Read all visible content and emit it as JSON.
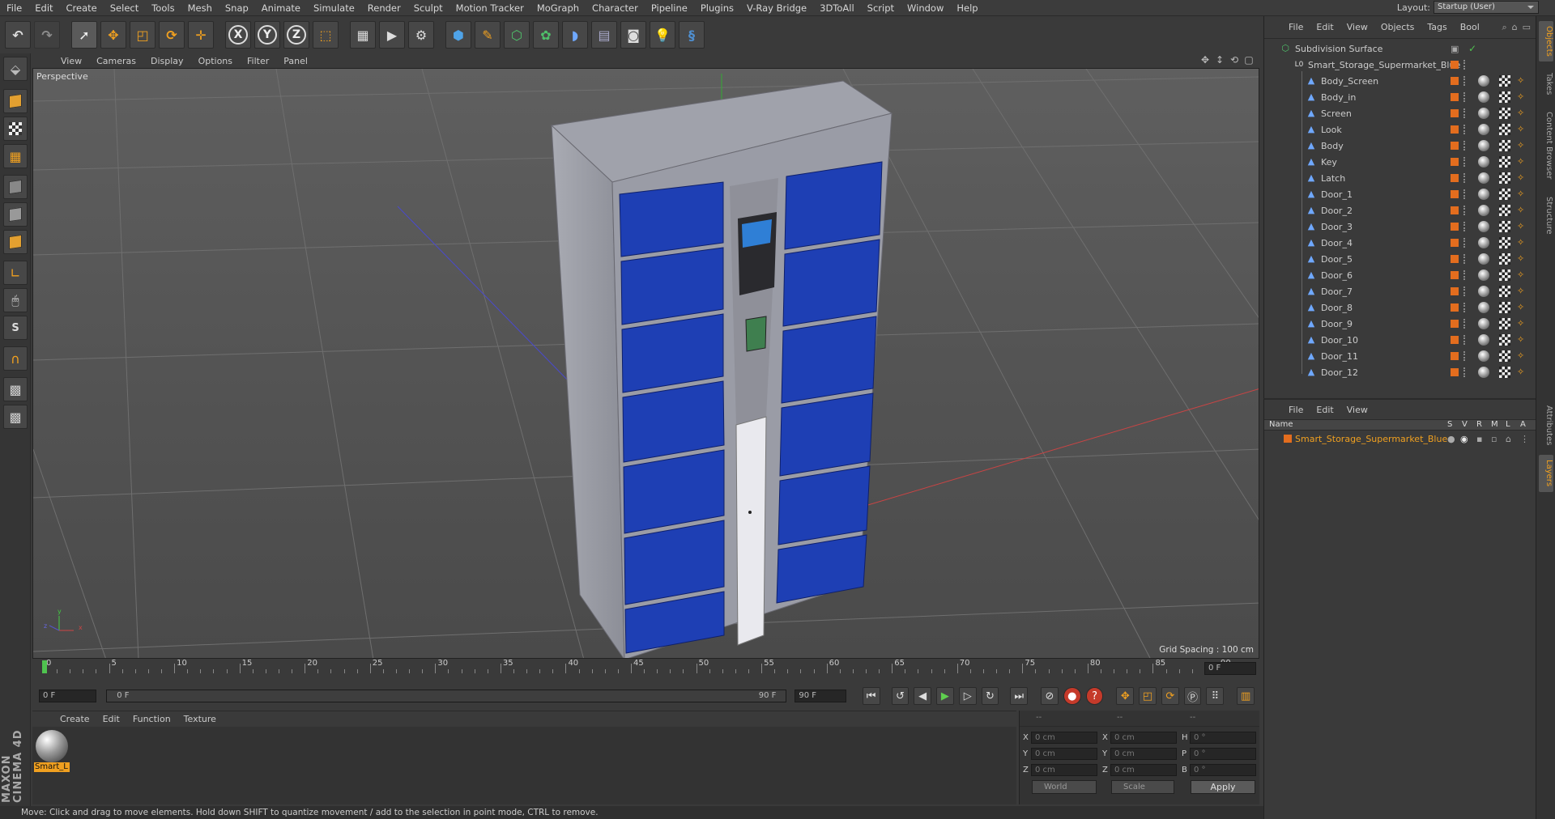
{
  "menubar": {
    "items": [
      "File",
      "Edit",
      "Create",
      "Select",
      "Tools",
      "Mesh",
      "Snap",
      "Animate",
      "Simulate",
      "Render",
      "Sculpt",
      "Motion Tracker",
      "MoGraph",
      "Character",
      "Pipeline",
      "Plugins",
      "V-Ray Bridge",
      "3DToAll",
      "Script",
      "Window",
      "Help"
    ],
    "layout_label": "Layout:",
    "layout_value": "Startup (User)"
  },
  "toolbar": {
    "axis_x": "X",
    "axis_y": "Y",
    "axis_z": "Z",
    "icons": [
      "undo-icon",
      "redo-icon",
      "select-arrow-icon",
      "move-icon",
      "scale-icon",
      "rotate-icon",
      "transform-icon",
      "axis-x-icon",
      "axis-y-icon",
      "axis-z-icon",
      "coordinate-system-icon",
      "render-view-icon",
      "render-picture-viewer-icon",
      "edit-render-settings-icon",
      "cube-icon",
      "pen-icon",
      "subdivision-icon",
      "cloner-icon",
      "deformer-icon",
      "floor-icon",
      "camera-icon",
      "light-icon",
      "python-icon"
    ]
  },
  "left_tools": {
    "s_label": "S",
    "brand": "MAXON CINEMA 4D"
  },
  "viewport": {
    "menu": [
      "View",
      "Cameras",
      "Display",
      "Options",
      "Filter",
      "Panel"
    ],
    "name": "Perspective",
    "grid_spacing": "Grid Spacing : 100 cm",
    "axis_x": "x",
    "axis_y": "y",
    "axis_z": "z"
  },
  "timeline": {
    "ticks": [
      0,
      5,
      10,
      15,
      20,
      25,
      30,
      35,
      40,
      45,
      50,
      55,
      60,
      65,
      70,
      75,
      80,
      85,
      90
    ],
    "current_frame_field": "0 F"
  },
  "controls": {
    "start_field": "0 F",
    "range_start": "0 F",
    "range_end": "90 F",
    "end_field": "90 F"
  },
  "material_manager": {
    "menu": [
      "Create",
      "Edit",
      "Function",
      "Texture"
    ],
    "material_name": "Smart_L"
  },
  "coordinates": {
    "header": [
      "--",
      "--",
      "--"
    ],
    "rows": [
      {
        "a": "X",
        "a_val": "0 cm",
        "b": "X",
        "b_val": "0 cm",
        "c": "H",
        "c_val": "0 °"
      },
      {
        "a": "Y",
        "a_val": "0 cm",
        "b": "Y",
        "b_val": "0 cm",
        "c": "P",
        "c_val": "0 °"
      },
      {
        "a": "Z",
        "a_val": "0 cm",
        "b": "Z",
        "b_val": "0 cm",
        "c": "B",
        "c_val": "0 °"
      }
    ],
    "space": "World",
    "mode": "Scale",
    "apply": "Apply"
  },
  "status": {
    "text": "Move: Click and drag to move elements. Hold down SHIFT to quantize movement / add to the selection in point mode, CTRL to remove."
  },
  "object_manager": {
    "menu": [
      "File",
      "Edit",
      "View",
      "Objects",
      "Tags",
      "Bool"
    ],
    "root": "Subdivision Surface",
    "group": "Smart_Storage_Supermarket_Blue",
    "children": [
      "Body_Screen",
      "Body_in",
      "Screen",
      "Look",
      "Body",
      "Key",
      "Latch",
      "Door_1",
      "Door_2",
      "Door_3",
      "Door_4",
      "Door_5",
      "Door_6",
      "Door_7",
      "Door_8",
      "Door_9",
      "Door_10",
      "Door_11",
      "Door_12"
    ]
  },
  "layer_manager": {
    "menu": [
      "File",
      "Edit",
      "View"
    ],
    "columns": {
      "name": "Name",
      "s": "S",
      "v": "V",
      "r": "R",
      "m": "M",
      "l": "L",
      "a": "A"
    },
    "layer": "Smart_Storage_Supermarket_Blue"
  },
  "side_tabs": {
    "objects": "Objects",
    "takes": "Takes",
    "content_browser": "Content Browser",
    "structure": "Structure",
    "attributes": "Attributes",
    "layers": "Layers"
  },
  "colors": {
    "accent": "#f0a020",
    "layer_color": "#e36d1e",
    "locker_blue": "#1e3fb4"
  }
}
